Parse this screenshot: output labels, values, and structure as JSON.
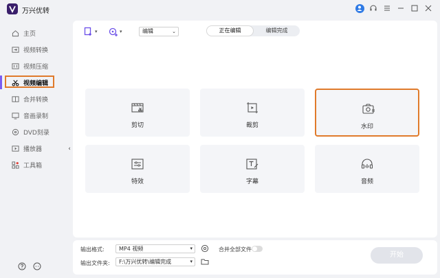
{
  "app": {
    "title": "万兴优转"
  },
  "sidebar": {
    "items": [
      {
        "label": "主页",
        "icon": "home-icon"
      },
      {
        "label": "视频转换",
        "icon": "convert-icon"
      },
      {
        "label": "视频压缩",
        "icon": "compress-icon"
      },
      {
        "label": "视频编辑",
        "icon": "scissors-icon",
        "active": true
      },
      {
        "label": "合并转换",
        "icon": "merge-icon"
      },
      {
        "label": "音画录制",
        "icon": "record-icon"
      },
      {
        "label": "DVD刻录",
        "icon": "dvd-icon"
      },
      {
        "label": "播放器",
        "icon": "player-icon"
      },
      {
        "label": "工具箱",
        "icon": "toolbox-icon"
      }
    ]
  },
  "toolbar": {
    "edit_select": "编辑",
    "tabs": [
      {
        "label": "正在编辑",
        "active": true
      },
      {
        "label": "编辑完成"
      }
    ]
  },
  "cards": [
    {
      "label": "剪切",
      "icon": "cut-video-icon"
    },
    {
      "label": "裁剪",
      "icon": "crop-icon"
    },
    {
      "label": "水印",
      "icon": "watermark-icon",
      "highlighted": true
    },
    {
      "label": "特效",
      "icon": "effects-icon"
    },
    {
      "label": "字幕",
      "icon": "subtitle-icon"
    },
    {
      "label": "音频",
      "icon": "audio-icon"
    }
  ],
  "bottom": {
    "format_label": "输出格式:",
    "format_value": "MP4 视频",
    "merge_label": "合并全部文件",
    "folder_label": "输出文件夹:",
    "folder_value": "F:\\万兴优转\\编辑完成",
    "start_label": "开始"
  },
  "colors": {
    "accent": "#7a5cf0",
    "highlight": "#e07a2a",
    "logo": "#3a1f6b"
  }
}
